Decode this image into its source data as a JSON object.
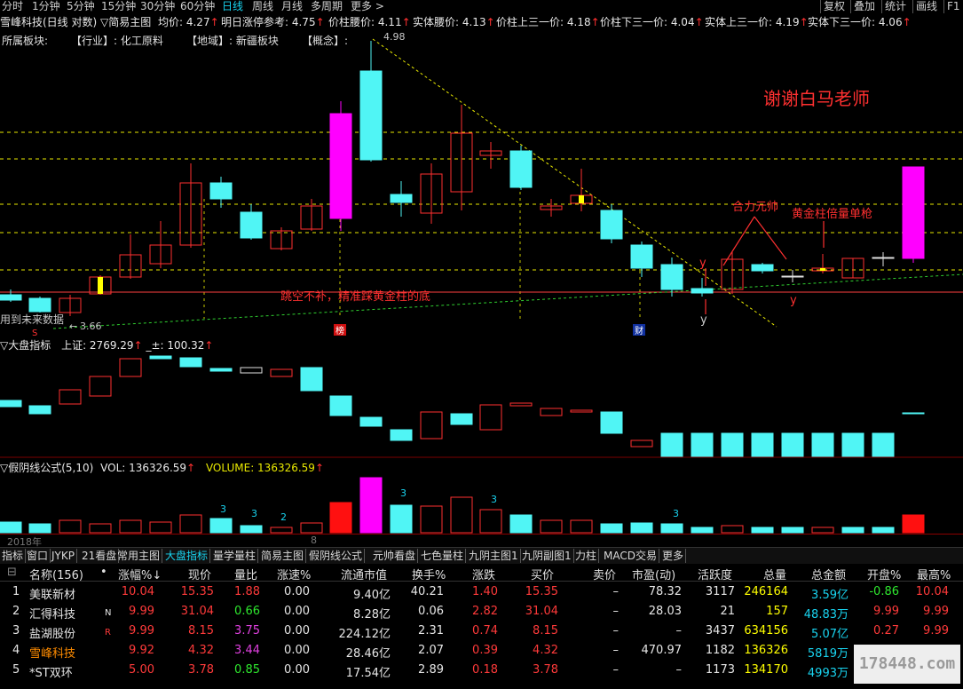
{
  "periods": [
    "分时",
    "1分钟",
    "5分钟",
    "15分钟",
    "30分钟",
    "60分钟",
    "日线",
    "周线",
    "月线",
    "多周期",
    "更多 >"
  ],
  "active_period": "日线",
  "right_buttons": [
    "复权",
    "叠加",
    "统计",
    "F1"
  ],
  "info": {
    "title": "雪峰科技(日线 对数) ▽简易主图",
    "items": [
      {
        "label": "均价: ",
        "value": "4.27",
        "arrow": "↑"
      },
      {
        "label": "明日涨停参考: ",
        "value": "4.75",
        "arrow": "↑"
      },
      {
        "label": "价柱腰价: ",
        "value": "4.11",
        "arrow": "↑"
      },
      {
        "label": "实体腰价: ",
        "value": "4.13",
        "arrow": "↑"
      },
      {
        "label": "价柱上三一价: ",
        "value": "4.18",
        "arrow": "↑"
      },
      {
        "label": "价柱下三一价: ",
        "value": "4.04",
        "arrow": "↑"
      },
      {
        "label": "实体上三一价: ",
        "value": "4.19",
        "arrow": "↑"
      },
      {
        "label": "实体下三一价: ",
        "value": "4.06",
        "arrow": "↑"
      }
    ]
  },
  "blocks": {
    "prefix": "所属板块:",
    "industry": "【行业】: 化工原料",
    "region": "【地域】: 新疆板块",
    "concept": "【概念】:"
  },
  "main_chart": {
    "annotations": {
      "high": "4.98",
      "low": "3.66",
      "thanks": "谢谢白马老师",
      "heli": "合力元帅",
      "golden": "黄金柱倍量单枪",
      "jump": "跳空不补，精准踩黄金柱的底",
      "future": "用到未来数据",
      "y1": "y",
      "y2": "y",
      "y3": "y",
      "mark_bang": "榜",
      "mark_cai": "财",
      "mark_s": "S"
    },
    "candles": [
      [
        0,
        0,
        0,
        0,
        "cyan"
      ],
      [
        0,
        0,
        0,
        0,
        "cyan"
      ],
      [
        0,
        0,
        0,
        0,
        "red"
      ],
      [
        0,
        0,
        0,
        0,
        "yellow"
      ]
    ]
  },
  "sub1": {
    "title": "▽大盘指标",
    "label": "上证: ",
    "value": "2769.29",
    "arrow": "↑",
    "label2": " _±: ",
    "value2": "100.32",
    "arrow2": "↑"
  },
  "sub2": {
    "title": "▽假阴线公式(5,10)",
    "vol_label": "VOL: ",
    "vol_value": "136326.59",
    "arrow": "↑",
    "volume_label": "VOLUME: ",
    "volume_value": "136326.59",
    "arrow2": "↑",
    "markers": [
      "3",
      "3",
      "2",
      "3",
      "3",
      "3"
    ]
  },
  "time_axis": {
    "year": "2018年",
    "mark": "8"
  },
  "tabs": [
    "指标",
    "窗口",
    "JYKP",
    "21看盘",
    "常用主图",
    "大盘指标",
    "量学量柱",
    "简易主图",
    "假阴线公式",
    "元帅看盘",
    "七色量柱",
    "九阴主图1",
    "九阴副图1",
    "力柱",
    "MACD交易",
    "更多"
  ],
  "active_tab": "大盘指标",
  "table": {
    "headers": [
      "名称(156)",
      "•",
      "涨幅%↓",
      "现价",
      "量比",
      "涨速%",
      "流通市值",
      "换手%",
      "涨跌",
      "买价",
      "卖价",
      "市盈(动)",
      "活跃度",
      "总量",
      "总金额",
      "开盘%",
      "最高%"
    ],
    "rows": [
      {
        "idx": "1",
        "flag": "",
        "name": "美联新材",
        "chg": "10.04",
        "price": "15.35",
        "ratio": "1.88",
        "speed": "0.00",
        "mcap": "9.40亿",
        "turn": "40.21",
        "diff": "1.40",
        "bid": "15.35",
        "ask": "–",
        "pe": "78.32",
        "act": "3117",
        "vol": "246164",
        "amt": "3.59亿",
        "open": "-0.86",
        "high": "10.04",
        "ratio_color": "c-red",
        "name_color": "c-white",
        "open_color": "c-green"
      },
      {
        "idx": "2",
        "flag": "N",
        "name": "汇得科技",
        "chg": "9.99",
        "price": "31.04",
        "ratio": "0.66",
        "speed": "0.00",
        "mcap": "8.28亿",
        "turn": "0.06",
        "diff": "2.82",
        "bid": "31.04",
        "ask": "–",
        "pe": "28.03",
        "act": "21",
        "vol": "157",
        "amt": "48.83万",
        "open": "9.99",
        "high": "9.99",
        "ratio_color": "c-green",
        "name_color": "c-white",
        "open_color": "c-red"
      },
      {
        "idx": "3",
        "flag": "R",
        "name": "盐湖股份",
        "chg": "9.99",
        "price": "8.15",
        "ratio": "3.75",
        "speed": "0.00",
        "mcap": "224.12亿",
        "turn": "2.31",
        "diff": "0.74",
        "bid": "8.15",
        "ask": "–",
        "pe": "–",
        "act": "3437",
        "vol": "634156",
        "amt": "5.07亿",
        "open": "0.27",
        "high": "9.99",
        "ratio_color": "c-purple",
        "name_color": "c-white",
        "open_color": "c-red"
      },
      {
        "idx": "4",
        "flag": "",
        "name": "雪峰科技",
        "chg": "9.92",
        "price": "4.32",
        "ratio": "3.44",
        "speed": "0.00",
        "mcap": "28.46亿",
        "turn": "2.07",
        "diff": "0.39",
        "bid": "4.32",
        "ask": "–",
        "pe": "470.97",
        "act": "1182",
        "vol": "136326",
        "amt": "5819万",
        "open": "",
        "high": "",
        "ratio_color": "c-purple",
        "name_color": "c-orange",
        "open_color": "c-red"
      },
      {
        "idx": "5",
        "flag": "",
        "name": "*ST双环",
        "chg": "5.00",
        "price": "3.78",
        "ratio": "0.85",
        "speed": "0.00",
        "mcap": "17.54亿",
        "turn": "2.89",
        "diff": "0.18",
        "bid": "3.78",
        "ask": "–",
        "pe": "–",
        "act": "1173",
        "vol": "134170",
        "amt": "4993万",
        "open": "",
        "high": "",
        "ratio_color": "c-green",
        "name_color": "c-white",
        "open_color": "c-red"
      }
    ]
  },
  "watermark": "178448.com",
  "colors": {
    "up": "#ff3030",
    "down": "#50f5f5",
    "accent": "#19d4f0",
    "magenta": "#ff00ff",
    "yellow": "#ffff00"
  }
}
